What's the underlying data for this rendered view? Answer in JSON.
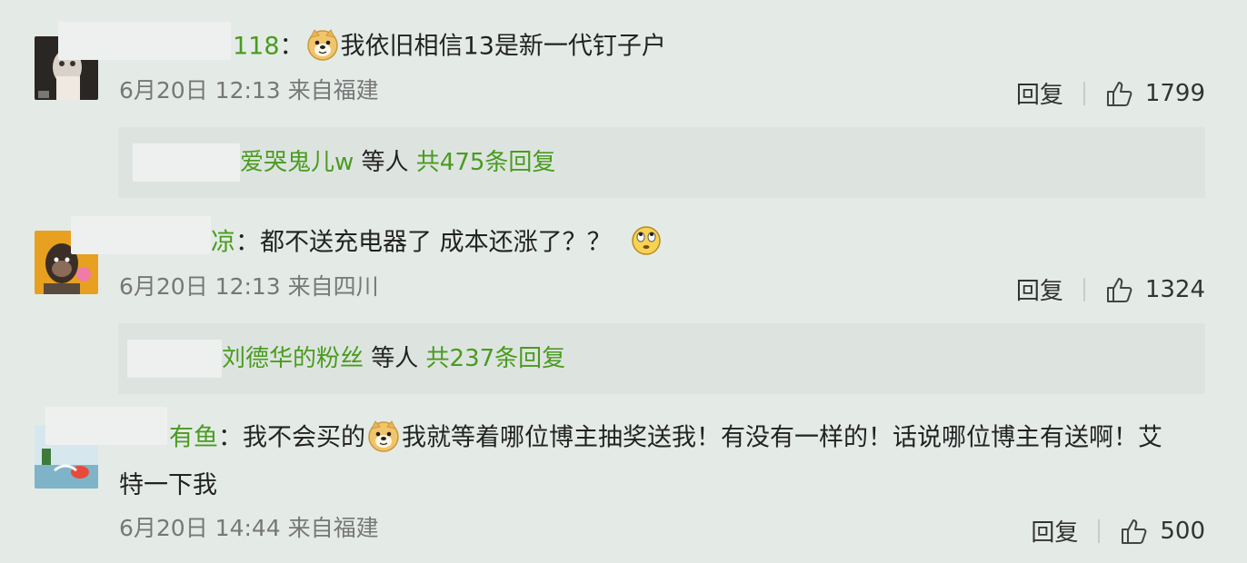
{
  "comments": [
    {
      "username_tail": "118",
      "colon": "：",
      "text_after_emoji": "我依旧相信13是新一代钉子户",
      "date": "6月20日 12:13 来自福建",
      "reply_label": "回复",
      "likes": "1799",
      "reply_summary": {
        "user": "爱哭鬼儿w",
        "middle": " 等人 ",
        "count": "共475条回复"
      }
    },
    {
      "username_tail": "凉",
      "colon": "：",
      "text": "都不送充电器了 成本还涨了？？",
      "date": "6月20日 12:13 来自四川",
      "reply_label": "回复",
      "likes": "1324",
      "reply_summary": {
        "user": "刘德华的粉丝",
        "middle": " 等人 ",
        "count": "共237条回复"
      }
    },
    {
      "username_tail": "有鱼",
      "colon": "：",
      "text_before_emoji": "我不会买的",
      "text_after_emoji": "我就等着哪位博主抽奖送我！有没有一样的！话说哪位博主有送啊！艾",
      "text_line2": "特一下我",
      "date": "6月20日 14:44 来自福建",
      "reply_label": "回复",
      "likes": "500"
    }
  ],
  "colors": {
    "username": "#4a9b1f",
    "background": "#e4ebe7",
    "reply_box": "#dde4e0"
  }
}
